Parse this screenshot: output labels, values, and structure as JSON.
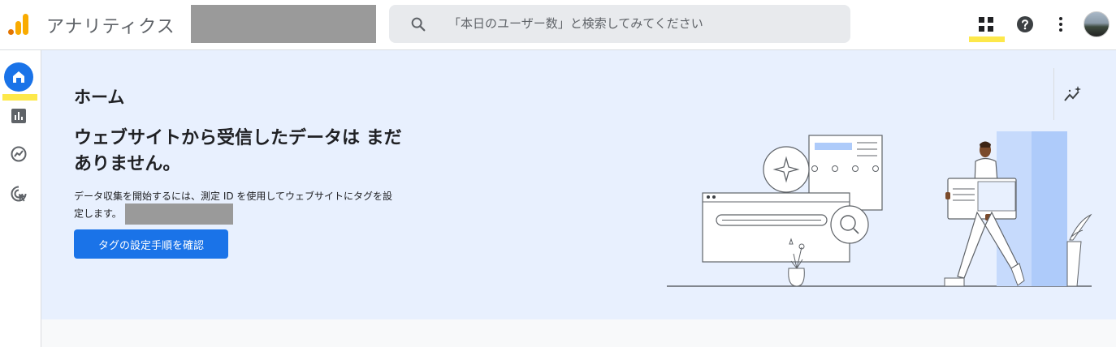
{
  "header": {
    "app_title": "アナリティクス",
    "search_placeholder": "「本日のユーザー数」と検索してみてください"
  },
  "icons": {
    "logo": "analytics-logo-icon",
    "search": "search-icon",
    "apps": "apps-grid-icon",
    "help": "help-icon",
    "more": "more-vert-icon",
    "home": "home-icon",
    "reports": "bar-chart-icon",
    "explore": "explore-icon",
    "advertising": "target-cursor-icon",
    "insights": "insights-sparkle-icon"
  },
  "colors": {
    "accent": "#1a73e8",
    "highlight": "#fde84a",
    "hero_bg": "#e8f0fe"
  },
  "main": {
    "page_title": "ホーム",
    "headline": "ウェブサイトから受信したデータは まだありません。",
    "description": "データ収集を開始するには、測定 ID を使用してウェブサイトにタグを設定します。",
    "cta_label": "タグの設定手順を確認"
  }
}
